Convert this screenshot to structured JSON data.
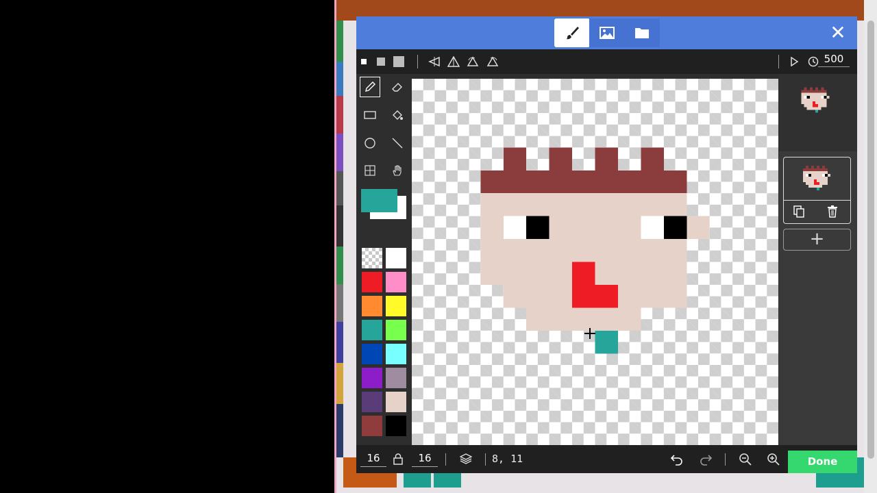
{
  "header": {
    "tabs": [
      {
        "name": "paint",
        "icon": "brush-icon",
        "active": true
      },
      {
        "name": "gallery",
        "icon": "image-icon",
        "active": false
      },
      {
        "name": "assets",
        "icon": "folder-icon",
        "active": false
      }
    ],
    "close_icon": "close-icon"
  },
  "toolbar": {
    "brush_sizes": [
      "small",
      "medium",
      "large"
    ],
    "transforms": [
      "flip-horizontal",
      "flip-vertical",
      "rotate-ccw",
      "rotate-cw"
    ],
    "play_icon": "play-icon",
    "timer_icon": "clock-icon",
    "frame_delay": "500"
  },
  "tools": [
    {
      "name": "pencil-tool",
      "selected": true
    },
    {
      "name": "eraser-tool"
    },
    {
      "name": "rectangle-tool"
    },
    {
      "name": "fill-tool"
    },
    {
      "name": "circle-tool"
    },
    {
      "name": "line-tool"
    },
    {
      "name": "marquee-tool"
    },
    {
      "name": "pan-tool"
    }
  ],
  "colors": {
    "primary": "#26a69a",
    "secondary": "#ffffff",
    "palette": [
      "transparent",
      "#ffffff",
      "#ee1c24",
      "#ff8ec8",
      "#ff8a30",
      "#fffa28",
      "#26a69a",
      "#78ff4e",
      "#0046b4",
      "#78ffff",
      "#8c1dc8",
      "#a08ca0",
      "#5a3c78",
      "#e6d2c8",
      "#913c3c",
      "#000000"
    ]
  },
  "sprite": {
    "width": 16,
    "height": 16,
    "pixels": [
      "................",
      "................",
      "................",
      "....r.r.r.r.....",
      "...rrrrrrrrr....",
      "...sssssssss....",
      "...swbsssswbs...",
      "...sssssssss....",
      "...ssssRssss....",
      "....sssRRsss....",
      ".....sssss......",
      "........t.......",
      "................",
      "................",
      "................",
      "................"
    ],
    "color_key": {
      "r": "#8b3d3d",
      "s": "#e6d2c8",
      "w": "#ffffff",
      "b": "#000000",
      "R": "#ee1c24",
      "t": "#26a69a"
    }
  },
  "frames_panel": {
    "copy_icon": "copy-icon",
    "delete_icon": "trash-icon",
    "add_label": "+"
  },
  "bottombar": {
    "canvas_width": "16",
    "canvas_height": "16",
    "lock_icon": "lock-icon",
    "layers_icon": "layers-icon",
    "cursor_coords": "8, 11",
    "undo_icon": "undo-icon",
    "redo_icon": "redo-icon",
    "zoom_out_icon": "zoom-out-icon",
    "zoom_in_icon": "zoom-in-icon",
    "done_label": "Done"
  }
}
